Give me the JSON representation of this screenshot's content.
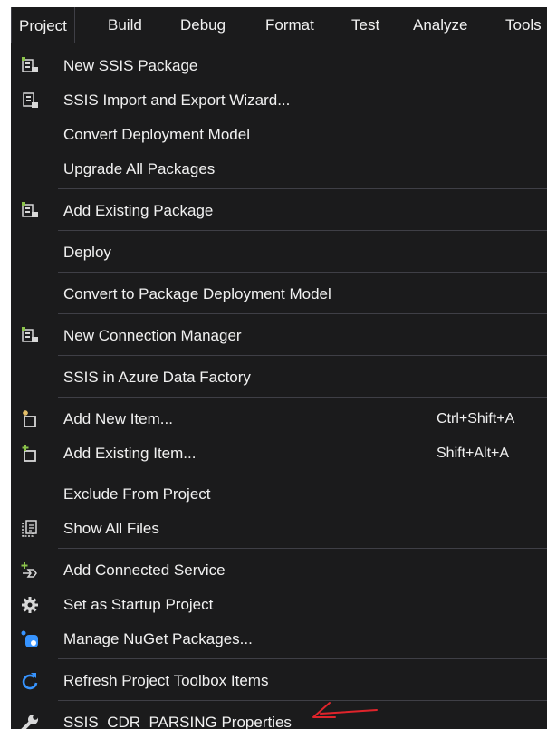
{
  "menubar": {
    "items": [
      "Project",
      "Build",
      "Debug",
      "Format",
      "Test",
      "Analyze",
      "Tools"
    ]
  },
  "menu": {
    "items": [
      {
        "label": "New SSIS Package",
        "icon": "ssis-package-icon"
      },
      {
        "label": "SSIS Import and Export Wizard...",
        "icon": "ssis-wizard-icon"
      },
      {
        "label": "Convert Deployment Model"
      },
      {
        "label": "Upgrade All Packages"
      },
      {
        "label": "Add Existing Package",
        "icon": "ssis-package-icon"
      },
      {
        "label": "Deploy"
      },
      {
        "label": "Convert to Package Deployment Model"
      },
      {
        "label": "New Connection Manager",
        "icon": "connection-manager-icon"
      },
      {
        "label": "SSIS in Azure Data Factory"
      },
      {
        "label": "Add New Item...",
        "shortcut": "Ctrl+Shift+A",
        "icon": "add-new-item-icon"
      },
      {
        "label": "Add Existing Item...",
        "shortcut": "Shift+Alt+A",
        "icon": "add-existing-item-icon"
      },
      {
        "label": "Exclude From Project"
      },
      {
        "label": "Show All Files",
        "icon": "show-all-files-icon"
      },
      {
        "label": "Add Connected Service",
        "icon": "connected-service-icon"
      },
      {
        "label": "Set as Startup Project",
        "icon": "gear-icon"
      },
      {
        "label": "Manage NuGet Packages...",
        "icon": "nuget-icon"
      },
      {
        "label": "Refresh Project Toolbox Items",
        "icon": "refresh-icon"
      },
      {
        "label": "SSIS_CDR_PARSING Properties",
        "icon": "wrench-icon"
      }
    ]
  },
  "colors": {
    "background": "#1b1b1c",
    "text": "#f1f1f1",
    "separator": "#3f3f46",
    "annotation_arrow": "#e0242b",
    "icon_green": "#8bc34a",
    "icon_blue": "#3794ff"
  }
}
